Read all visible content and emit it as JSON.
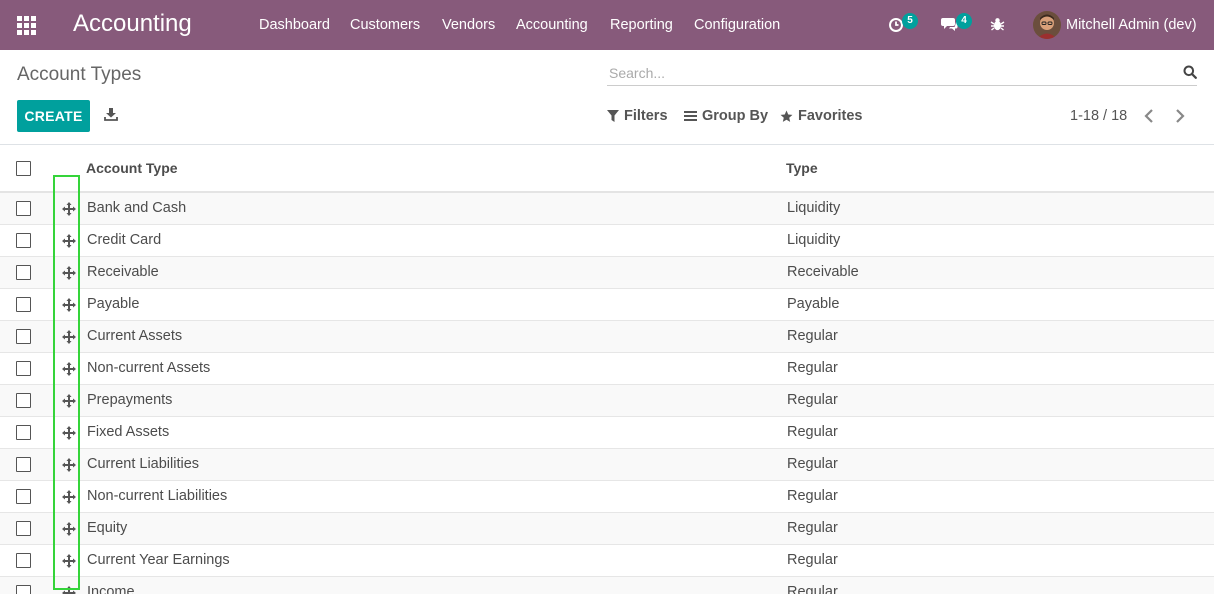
{
  "navbar": {
    "app_title": "Accounting",
    "menus": [
      "Dashboard",
      "Customers",
      "Vendors",
      "Accounting",
      "Reporting",
      "Configuration"
    ],
    "activity_count": "5",
    "message_count": "4",
    "user_name": "Mitchell Admin (dev)",
    "bg_color": "#875a7b"
  },
  "control_panel": {
    "title": "Account Types",
    "search_placeholder": "Search...",
    "create_label": "CREATE",
    "filters_label": "Filters",
    "group_by_label": "Group By",
    "favorites_label": "Favorites",
    "pager": "1-18 / 18",
    "accent_color": "#00a09d"
  },
  "table": {
    "columns": [
      "Account Type",
      "Type"
    ],
    "rows": [
      {
        "name": "Bank and Cash",
        "type": "Liquidity"
      },
      {
        "name": "Credit Card",
        "type": "Liquidity"
      },
      {
        "name": "Receivable",
        "type": "Receivable"
      },
      {
        "name": "Payable",
        "type": "Payable"
      },
      {
        "name": "Current Assets",
        "type": "Regular"
      },
      {
        "name": "Non-current Assets",
        "type": "Regular"
      },
      {
        "name": "Prepayments",
        "type": "Regular"
      },
      {
        "name": "Fixed Assets",
        "type": "Regular"
      },
      {
        "name": "Current Liabilities",
        "type": "Regular"
      },
      {
        "name": "Non-current Liabilities",
        "type": "Regular"
      },
      {
        "name": "Equity",
        "type": "Regular"
      },
      {
        "name": "Current Year Earnings",
        "type": "Regular"
      },
      {
        "name": "Income",
        "type": "Regular"
      }
    ]
  }
}
